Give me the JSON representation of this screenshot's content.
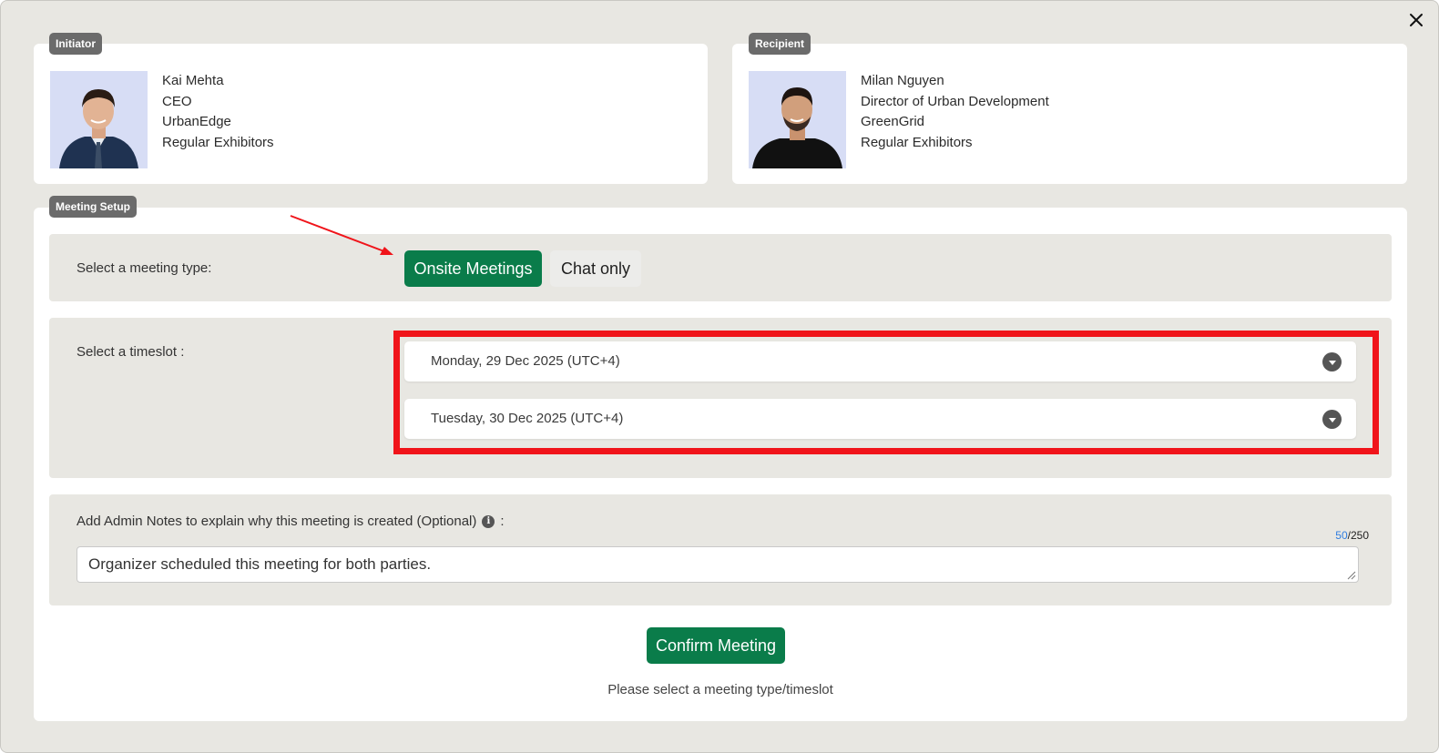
{
  "initiator": {
    "tag": "Initiator",
    "name": "Kai Mehta",
    "title": "CEO",
    "company": "UrbanEdge",
    "category": "Regular Exhibitors"
  },
  "recipient": {
    "tag": "Recipient",
    "name": "Milan Nguyen",
    "title": "Director of Urban Development",
    "company": "GreenGrid",
    "category": "Regular Exhibitors"
  },
  "setup": {
    "tag": "Meeting Setup",
    "type_label": "Select a meeting type:",
    "type_options": [
      "Onsite Meetings",
      "Chat only"
    ],
    "selected_type": "Onsite Meetings",
    "timeslot_label": "Select a timeslot :",
    "timeslots": [
      "Monday, 29 Dec 2025 (UTC+4)",
      "Tuesday, 30 Dec 2025 (UTC+4)"
    ],
    "notes_label": "Add Admin Notes to explain why this meeting is created (Optional)",
    "notes_label_suffix": ":",
    "notes_value": "Organizer scheduled this meeting for both parties.",
    "notes_count": "50",
    "notes_max": "/250",
    "confirm_label": "Confirm Meeting",
    "hint": "Please select a meeting type/timeslot"
  },
  "colors": {
    "primary": "#0a7c4a",
    "annotation": "#f0141a",
    "background": "#e8e7e2"
  }
}
